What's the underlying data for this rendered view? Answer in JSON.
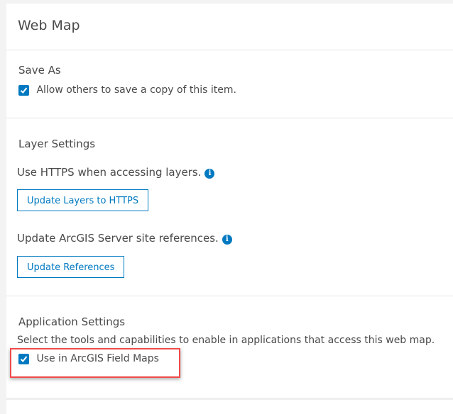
{
  "header": {
    "title": "Web Map"
  },
  "save_as": {
    "heading": "Save As",
    "checkbox_label": "Allow others to save a copy of this item.",
    "checked": true
  },
  "layer_settings": {
    "heading": "Layer Settings",
    "https_text": "Use HTTPS when accessing layers.",
    "https_button": "Update Layers to HTTPS",
    "server_text": "Update ArcGIS Server site references.",
    "server_button": "Update References",
    "info_glyph": "i"
  },
  "application_settings": {
    "heading": "Application Settings",
    "description": "Select the tools and capabilities to enable in applications that access this web map.",
    "field_maps_label": "Use in ArcGIS Field Maps",
    "checked": true
  },
  "colors": {
    "accent": "#0079c1",
    "highlight": "#f04a4a"
  }
}
